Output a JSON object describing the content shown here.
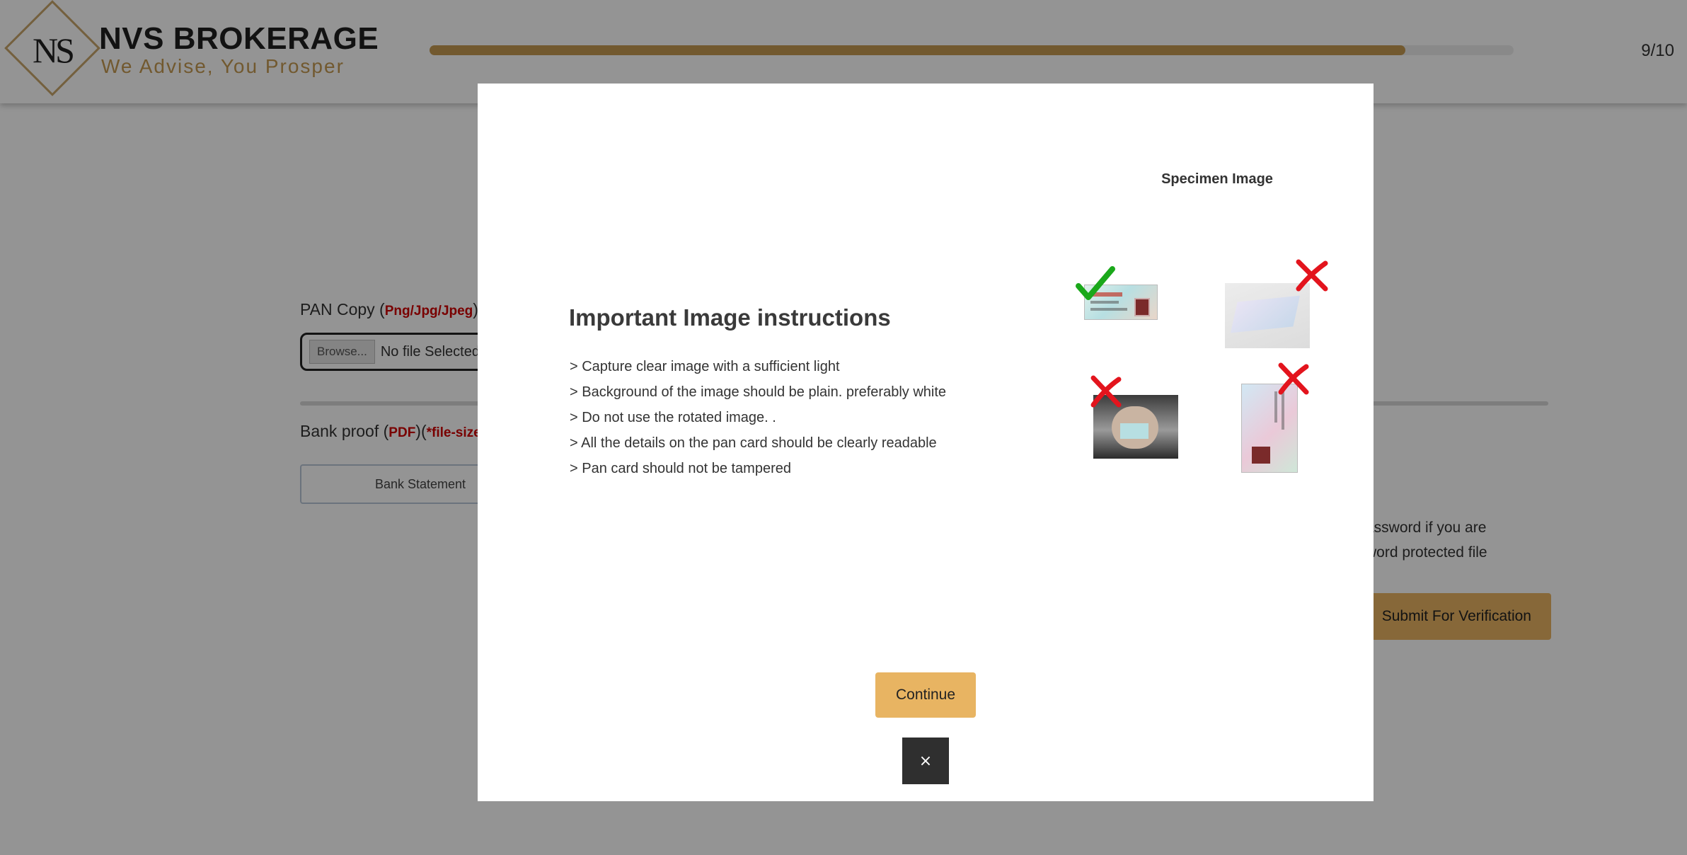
{
  "header": {
    "brand_letters": "NS",
    "brand_name": "NVS BROKERAGE",
    "brand_tagline": "We Advise, You Prosper",
    "progress": 0.9,
    "step_counter": "9/10"
  },
  "form": {
    "pan_label": "PAN Copy (",
    "pan_formats": "Png/Jpg/Jpeg",
    "pan_label_end": ")",
    "browse_label": "Browse...",
    "file_status": "No file Selected",
    "bank_label": "Bank proof (",
    "bank_format": "PDF",
    "bank_label_mid": ")(",
    "bank_size_note": "*file-size",
    "bank_option": "Bank Statement",
    "password_note_line1": "assword if you are",
    "password_note_line2": "word protected file",
    "submit_label": "Submit For Verification"
  },
  "modal": {
    "specimen_title": "Specimen Image",
    "title": "Important Image instructions",
    "instructions": [
      "> Capture clear image with a sufficient light",
      "> Background of the image should be plain. preferably white",
      "> Do not use the rotated image. .",
      ">  All the details on the pan card should be clearly readable",
      "> Pan card should not be tampered"
    ],
    "continue_label": "Continue",
    "close_label": "×"
  },
  "colors": {
    "accent": "#c49a52",
    "button": "#e8b462",
    "valid": "#1aa81a",
    "invalid": "#e3141d"
  },
  "icons": {
    "valid": "checkmark-icon",
    "invalid": "cross-icon"
  }
}
